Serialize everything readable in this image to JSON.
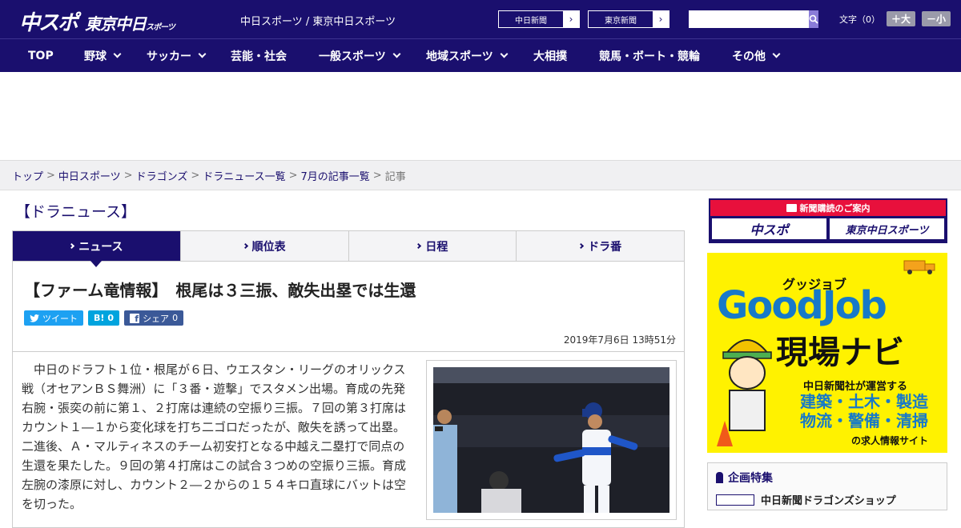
{
  "header": {
    "logo_chuspo": "中スポ",
    "logo_tokyo": "東京中日",
    "logo_tokyo_sub": "スポーツ",
    "site_name": "中日スポーツ / 東京中日スポーツ",
    "ext_links": [
      {
        "label": "中日新聞"
      },
      {
        "label": "東京新聞"
      }
    ],
    "search_placeholder": "",
    "font_label": "文字（0）",
    "font_larger": "＋大",
    "font_smaller": "－小"
  },
  "nav": {
    "items": [
      {
        "label": "TOP",
        "dropdown": false
      },
      {
        "label": "野球",
        "dropdown": true
      },
      {
        "label": "サッカー",
        "dropdown": true
      },
      {
        "label": "芸能・社会",
        "dropdown": false
      },
      {
        "label": "一般スポーツ",
        "dropdown": true
      },
      {
        "label": "地域スポーツ",
        "dropdown": true
      },
      {
        "label": "大相撲",
        "dropdown": false
      },
      {
        "label": "競馬・ボート・競輪",
        "dropdown": false
      },
      {
        "label": "その他",
        "dropdown": true
      }
    ]
  },
  "breadcrumb": {
    "items": [
      "トップ",
      "中日スポーツ",
      "ドラゴンズ",
      "ドラニュース一覧",
      "7月の記事一覧"
    ],
    "current": "記事",
    "separator": ">"
  },
  "section": {
    "title": "【ドラニュース】"
  },
  "tabs": [
    {
      "label": "ニュース",
      "active": true
    },
    {
      "label": "順位表",
      "active": false
    },
    {
      "label": "日程",
      "active": false
    },
    {
      "label": "ドラ番",
      "active": false
    }
  ],
  "article": {
    "headline": "【ファーム竜情報】　根尾は３三振、敵失出塁では生還",
    "share": {
      "tweet": "ツイート",
      "hatena_count": "0",
      "facebook": "シェア",
      "facebook_count": "0"
    },
    "date": "2019年7月6日 13時51分",
    "body": "中日のドラフト１位・根尾が６日、ウエスタン・リーグのオリックス戦（オセアンＢＳ舞洲）に「３番・遊撃」でスタメン出場。育成の先発右腕・張奕の前に第１、２打席は連続の空振り三振。７回の第３打席はカウント１―１から変化球を打ち二ゴロだったが、敵失を誘って出塁。二進後、Ａ・マルティネスのチーム初安打となる中越え二塁打で同点の生還を果たした。９回の第４打席はこの試合３つめの空振り三振。育成左腕の漆原に対し、カウント２―２からの１５４キロ直球にバットは空を切った。"
  },
  "sidebar": {
    "subscribe_title": "新聞購読のご案内",
    "subscribe_logos": [
      "中スポ",
      "東京中日スポーツ"
    ],
    "job_ad": {
      "tagline": "グッジョブ",
      "brand": "GoodJob",
      "title": "現場ナビ",
      "by": "中日新聞社が運営する",
      "categories": "建築・土木・製造 物流・警備・清掃",
      "footer": "の求人情報サイト"
    },
    "kikaku": {
      "title": "企画特集",
      "first_item": "中日新聞ドラゴンズショップ"
    }
  },
  "colors": {
    "brand_navy": "#1a0f6e",
    "accent_red": "#e8103c",
    "job_yellow": "#fff200",
    "job_blue": "#1779c8"
  }
}
